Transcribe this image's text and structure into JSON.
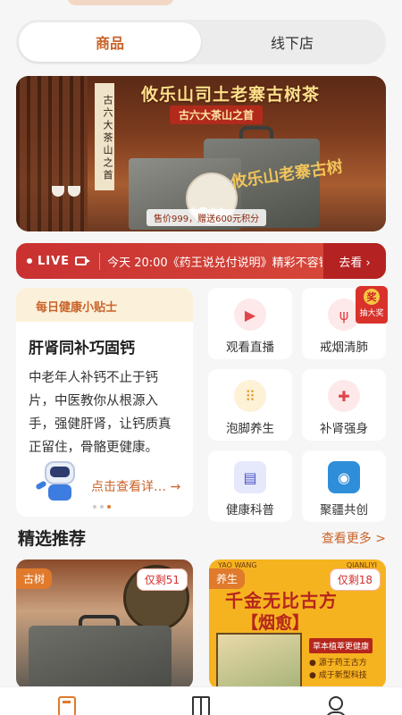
{
  "segment_tabs": [
    {
      "label": "商品",
      "active": true
    },
    {
      "label": "线下店",
      "active": false
    }
  ],
  "banner": {
    "title": "攸乐山司土老寨古树茶",
    "subtitle": "古六大茶山之首",
    "scroll_text": "古六大茶山之首",
    "calligraphy": "攸乐山老寨古树",
    "price_note": "售价999，赠送600元积分",
    "slide_count": 4,
    "active_slide": 2
  },
  "live_bar": {
    "tag": "LIVE",
    "ticker": "今天 20:00《药王说兑付说明》精彩不容错过",
    "action": "去看 ›",
    "colors": {
      "bg_start": "#c93131",
      "bg_end": "#d84a3b"
    }
  },
  "health_tip": {
    "header": "每日健康小贴士",
    "title": "肝肾同补巧固钙",
    "body": "中老年人补钙不止于钙片，中医教你从根源入手，强健肝肾，让钙质真正留住，骨骼更健康。",
    "cta": "点击查看详… →",
    "pages": 3,
    "active_page": 3
  },
  "quick_entries": [
    {
      "label": "观看直播",
      "icon": "video-camera-icon",
      "glyph": "▶",
      "bg": "#fde9ea",
      "fg": "#e0464a"
    },
    {
      "label": "戒烟清肺",
      "icon": "lungs-icon",
      "glyph": "ψ",
      "bg": "#fde9ea",
      "fg": "#e0464a",
      "badge": {
        "mark": "奖",
        "text": "抽大奖"
      }
    },
    {
      "label": "泡脚养生",
      "icon": "footprints-icon",
      "glyph": "⠿",
      "bg": "#fdf1d6",
      "fg": "#e0a12c"
    },
    {
      "label": "补肾强身",
      "icon": "medicine-box-icon",
      "glyph": "✚",
      "bg": "#fde9ea",
      "fg": "#e0464a"
    },
    {
      "label": "健康科普",
      "icon": "book-icon",
      "glyph": "▤",
      "bg": "#e6e8fb",
      "fg": "#4a55c8"
    },
    {
      "label": "聚疆共创",
      "icon": "partner-logo-icon",
      "glyph": "◉",
      "bg": "#2f8ed9",
      "fg": "#ffffff"
    }
  ],
  "section": {
    "title": "精选推荐",
    "more": "查看更多 >"
  },
  "products": [
    {
      "tag": "古树",
      "stock": "仅剩51"
    },
    {
      "tag": "养生",
      "stock": "仅剩18",
      "brand_left": "YAO WANG",
      "brand_right": "QIANLIYI",
      "headline_1": "千金无比古方",
      "headline_2": "【烟愈】",
      "ribbon": "草本植萃更健康",
      "point_1": "● 源于药王古方",
      "point_2": "● 成于新型科技"
    }
  ],
  "bottom_nav": [
    {
      "icon": "home-icon",
      "active": true
    },
    {
      "icon": "gift-icon",
      "active": false
    },
    {
      "icon": "user-icon",
      "active": false
    }
  ]
}
